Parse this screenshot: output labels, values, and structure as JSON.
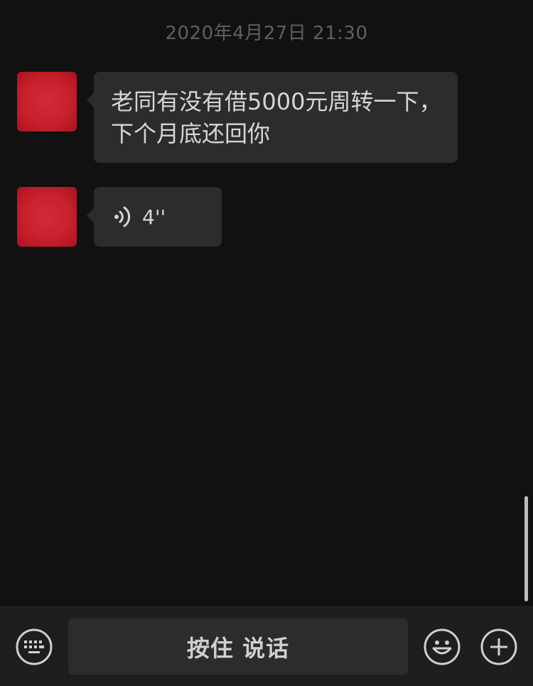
{
  "chat": {
    "timestamp": "2020年4月27日 21:30",
    "messages": [
      {
        "type": "text",
        "text": "老同有没有借5000元周转一下，下个月底还回你"
      },
      {
        "type": "voice",
        "duration": "4''"
      }
    ]
  },
  "input_bar": {
    "keyboard_icon": "keyboard-icon",
    "hold_to_talk_label": "按住 说话",
    "emoji_icon": "emoji-icon",
    "add_icon": "plus-icon"
  },
  "colors": {
    "background": "#111111",
    "bubble": "#2c2c2c",
    "avatar": "#c8202d",
    "text": "#d6d6d6",
    "timestamp": "#5f5f5f"
  }
}
